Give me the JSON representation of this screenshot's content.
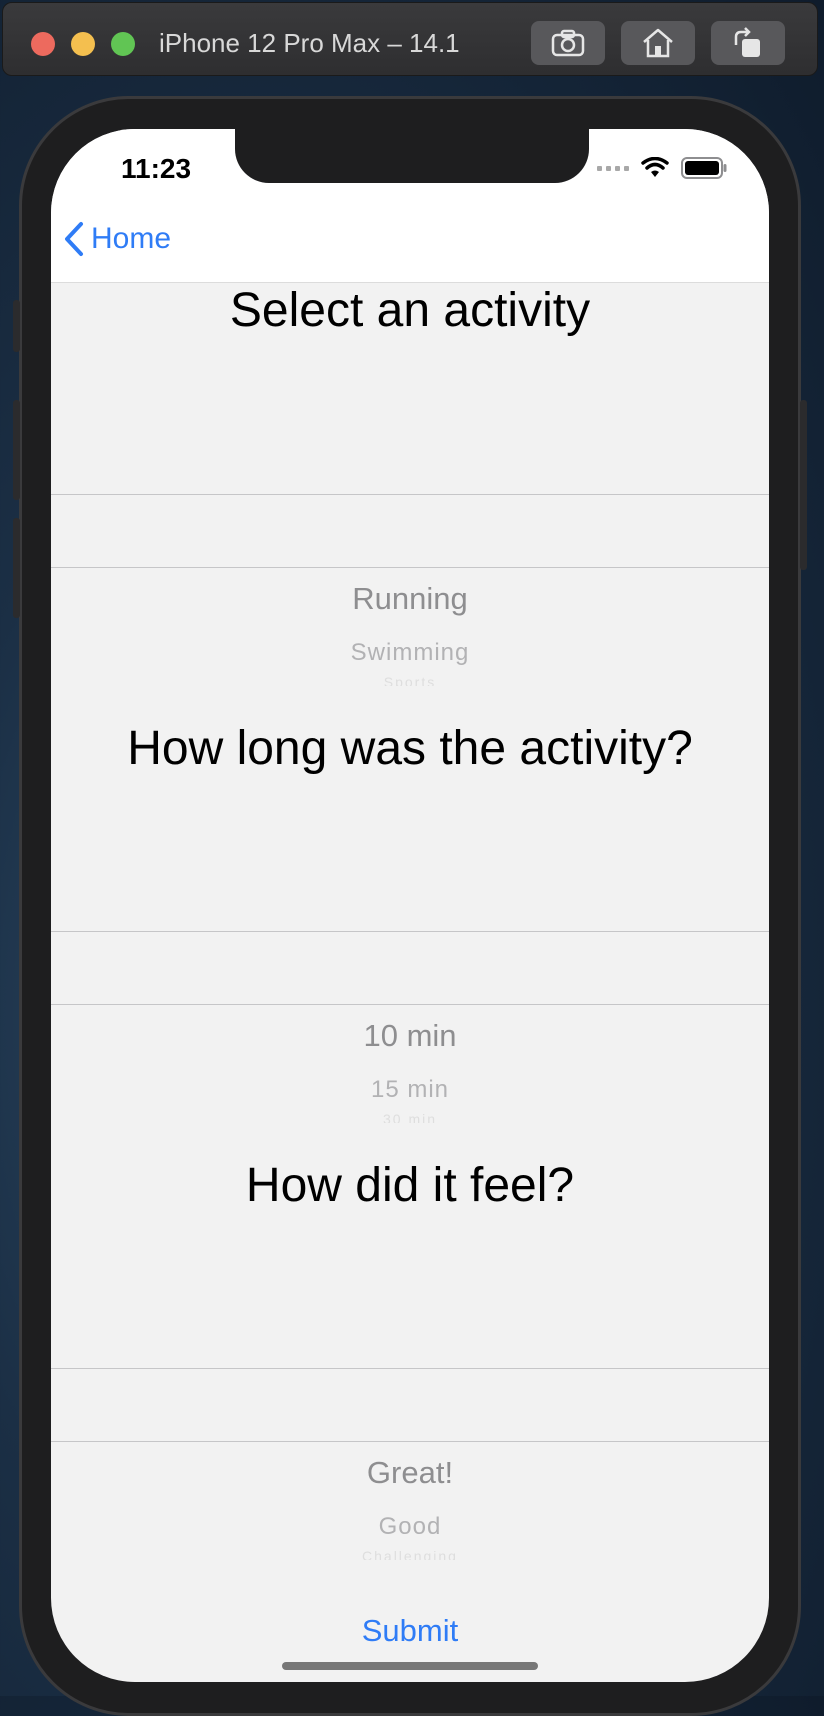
{
  "simulator": {
    "title": "iPhone 12 Pro Max – 14.1",
    "buttons": [
      "screenshot-icon",
      "home-icon",
      "rotate-icon"
    ]
  },
  "status_bar": {
    "time": "11:23"
  },
  "nav": {
    "back_label": "Home"
  },
  "sections": [
    {
      "title": "Select an activity",
      "picker": {
        "items": [
          "Running",
          "Swimming",
          "Sports"
        ]
      }
    },
    {
      "title": "How long was the activity?",
      "picker": {
        "items": [
          "10 min",
          "15 min",
          "30 min"
        ]
      }
    },
    {
      "title": "How did it feel?",
      "picker": {
        "items": [
          "Great!",
          "Good",
          "Challenging"
        ]
      }
    }
  ],
  "submit_label": "Submit",
  "colors": {
    "accent": "#2f7cf6",
    "background": "#f2f2f2",
    "nav_background": "#ffffff"
  }
}
